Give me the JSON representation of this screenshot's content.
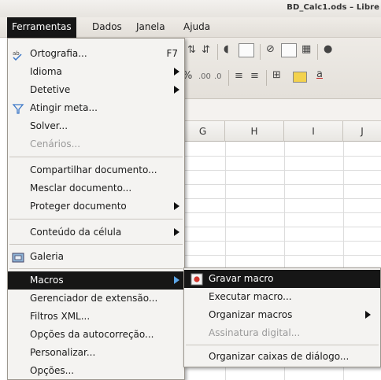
{
  "window": {
    "title": "BD_Calc1.ods – Libre"
  },
  "menubar": [
    {
      "label": "Ferramentas",
      "active": true
    },
    {
      "label": "Dados"
    },
    {
      "label": "Janela"
    },
    {
      "label": "Ajuda"
    }
  ],
  "sheet": {
    "columns": [
      "G",
      "H",
      "I",
      "J"
    ]
  },
  "menu": {
    "items": [
      {
        "label": "Ortografia...",
        "accel": "F7",
        "icon": "spelling-icon"
      },
      {
        "label": "Idioma",
        "submenu": true
      },
      {
        "label": "Detetive",
        "submenu": true
      },
      {
        "label": "Atingir meta...",
        "icon": "goal-seek-icon"
      },
      {
        "label": "Solver..."
      },
      {
        "label": "Cenários...",
        "disabled": true
      },
      {
        "label": "Compartilhar documento..."
      },
      {
        "label": "Mesclar documento..."
      },
      {
        "label": "Proteger documento",
        "submenu": true
      },
      {
        "label": "Conteúdo da célula",
        "submenu": true
      },
      {
        "label": "Galeria",
        "icon": "gallery-icon"
      },
      {
        "label": "Macros",
        "submenu": true,
        "highlighted": true
      },
      {
        "label": "Gerenciador de extensão..."
      },
      {
        "label": "Filtros XML..."
      },
      {
        "label": "Opções da autocorreção..."
      },
      {
        "label": "Personalizar..."
      },
      {
        "label": "Opções..."
      }
    ]
  },
  "submenu": {
    "items": [
      {
        "label": "Gravar macro",
        "icon": "record-macro-icon",
        "highlighted": true
      },
      {
        "label": "Executar macro..."
      },
      {
        "label": "Organizar macros",
        "submenu": true
      },
      {
        "label": "Assinatura digital...",
        "disabled": true
      },
      {
        "label": "Organizar caixas de diálogo..."
      }
    ]
  },
  "colors": {
    "highlight": "#161616",
    "menu_bg": "#f4f3f1",
    "arrow_highlight": "#5da6e8"
  }
}
